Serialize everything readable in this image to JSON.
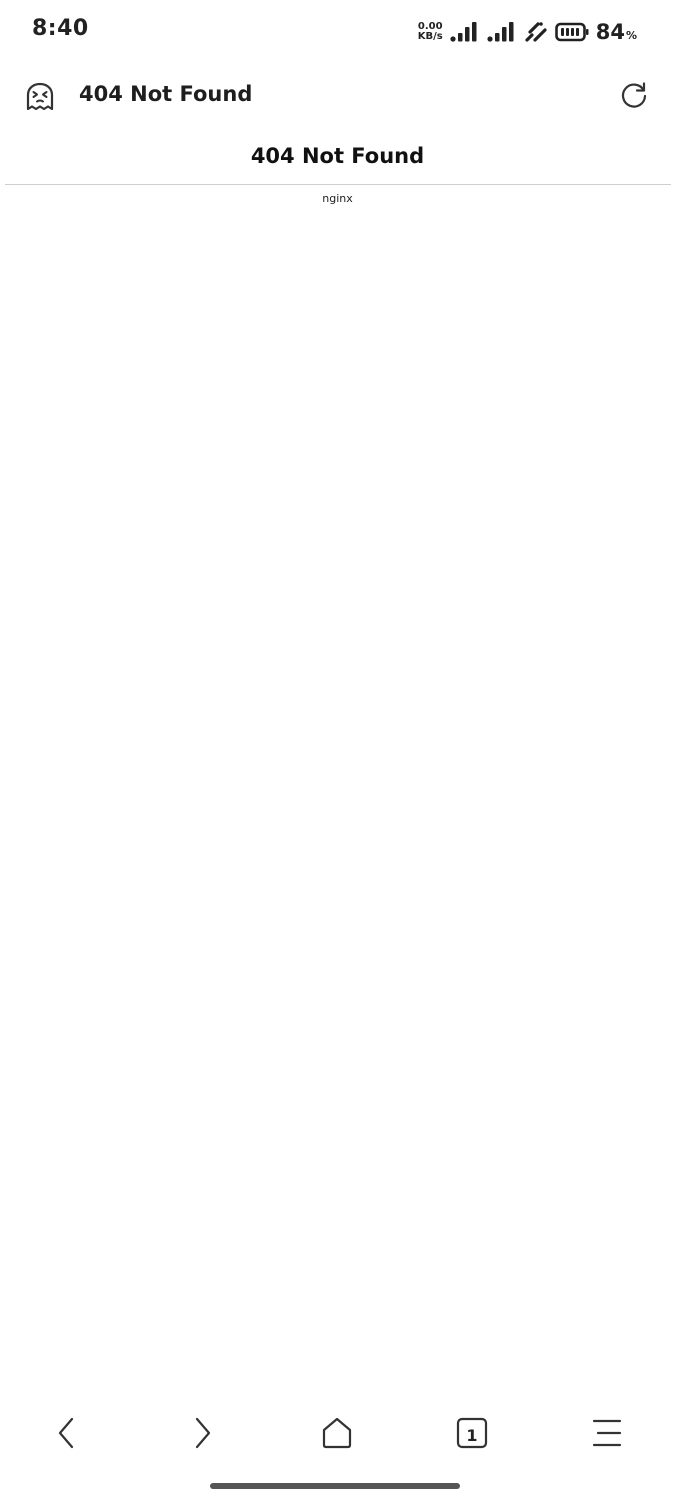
{
  "status_bar": {
    "time": "8:40",
    "net_speed_value": "0.00",
    "net_speed_unit": "KB/s",
    "battery_percent": "84",
    "battery_unit": "%",
    "icons": [
      "signal-icon",
      "signal-icon",
      "wifi-icon",
      "battery-icon"
    ]
  },
  "toolbar": {
    "site_icon": "ghost-face-icon",
    "page_title": "404 Not Found",
    "reload_icon": "reload-icon"
  },
  "content": {
    "heading": "404 Not Found",
    "server": "nginx"
  },
  "bottom_nav": {
    "tab_count": "1",
    "icons": [
      "back-arrow-icon",
      "forward-arrow-icon",
      "home-icon",
      "tabs-icon",
      "menu-icon"
    ]
  }
}
